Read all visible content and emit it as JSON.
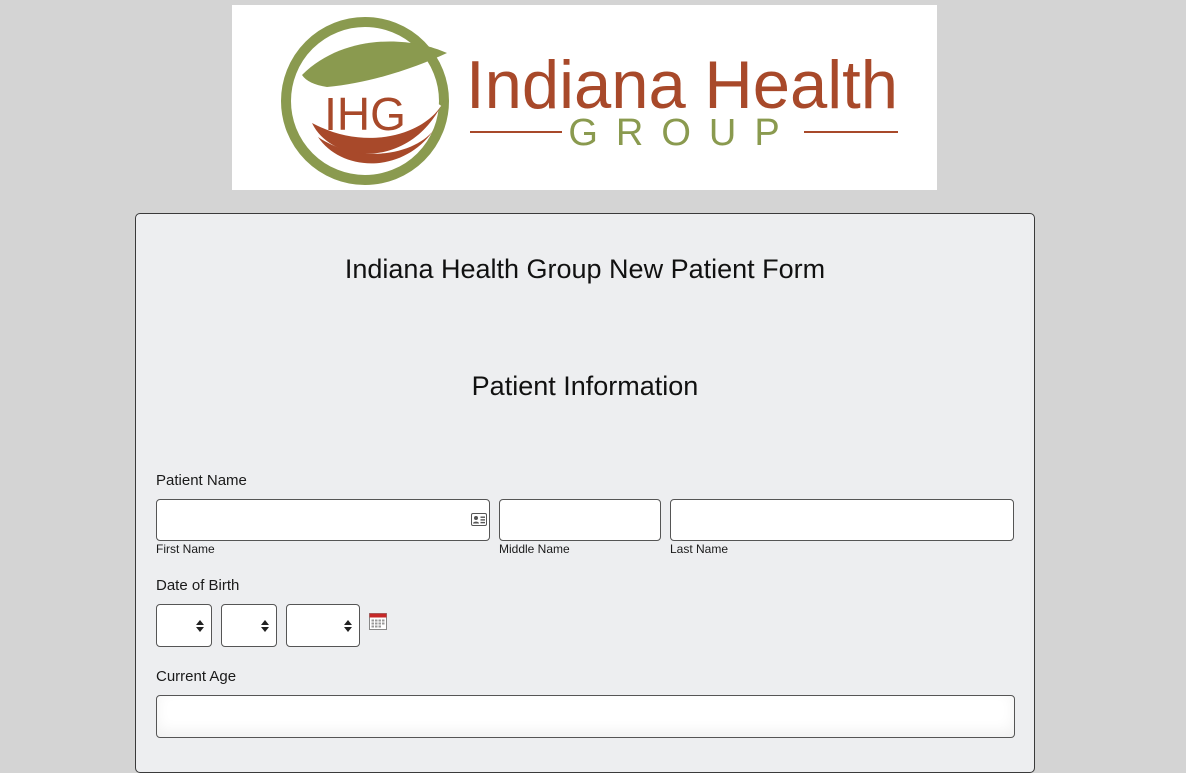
{
  "logo": {
    "monogram": "IHG",
    "name_line1": "Indiana Health",
    "name_line2": "GROUP",
    "colors": {
      "green": "#8a9a4f",
      "rust": "#a8492a"
    }
  },
  "form": {
    "title": "Indiana Health Group New Patient Form",
    "section_title": "Patient Information",
    "patient_name": {
      "label": "Patient Name",
      "first_name": {
        "sublabel": "First Name",
        "value": ""
      },
      "middle_name": {
        "sublabel": "Middle Name",
        "value": ""
      },
      "last_name": {
        "sublabel": "Last Name",
        "value": ""
      }
    },
    "date_of_birth": {
      "label": "Date of Birth",
      "month": "",
      "day": "",
      "year": ""
    },
    "current_age": {
      "label": "Current Age",
      "value": ""
    }
  },
  "icons": {
    "contact_card": "contact-card-icon",
    "calendar": "calendar-icon",
    "select_arrows": "select-arrows-icon"
  }
}
